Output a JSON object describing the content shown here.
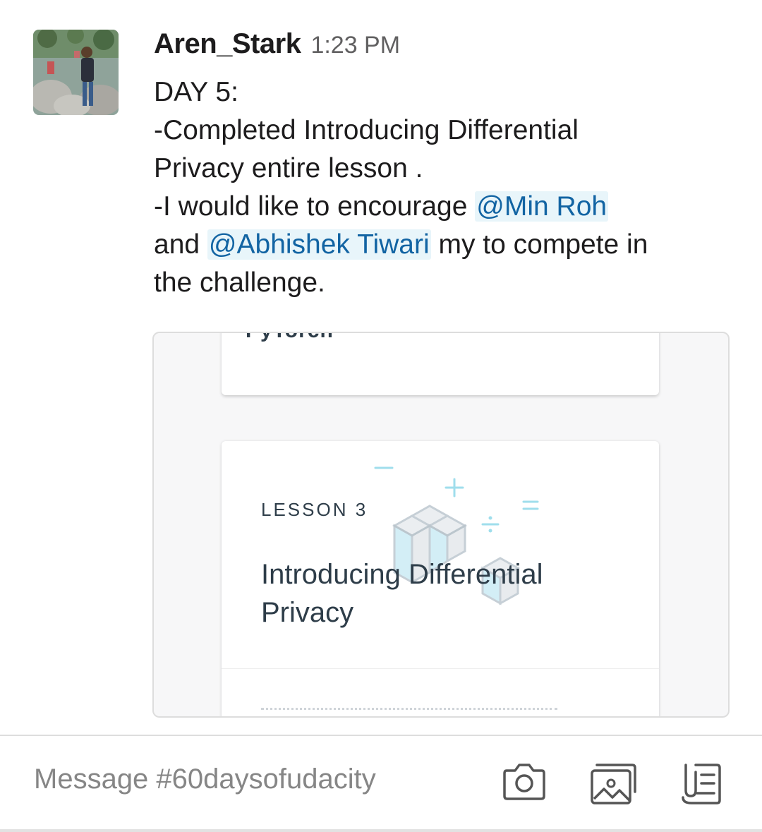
{
  "message": {
    "author": "Aren_Stark",
    "time": "1:23 PM",
    "avatar_icon": "user-photo-avatar",
    "line1": "DAY 5:",
    "line2": "-Completed Introducing Differential",
    "line3": "Privacy entire lesson .",
    "line4_prefix": "-I would like to encourage ",
    "mention1": "@Min Roh",
    "line5_prefix": " and ",
    "mention2": "@Abhishek Tiwari",
    "line5_suffix": " my to compete in",
    "line6": "the challenge."
  },
  "preview": {
    "top_card_title": "PyTorch",
    "lesson_label": "LESSON 3",
    "lesson_title": "Introducing Differential Privacy"
  },
  "composer": {
    "placeholder": "Message #60daysofudacity",
    "icons": [
      "camera-icon",
      "image-icon",
      "attachment-icon"
    ]
  },
  "colors": {
    "mention_text": "#1264a3",
    "mention_bg": "#e8f5fa",
    "deco_cyan": "#7fd3e6"
  }
}
